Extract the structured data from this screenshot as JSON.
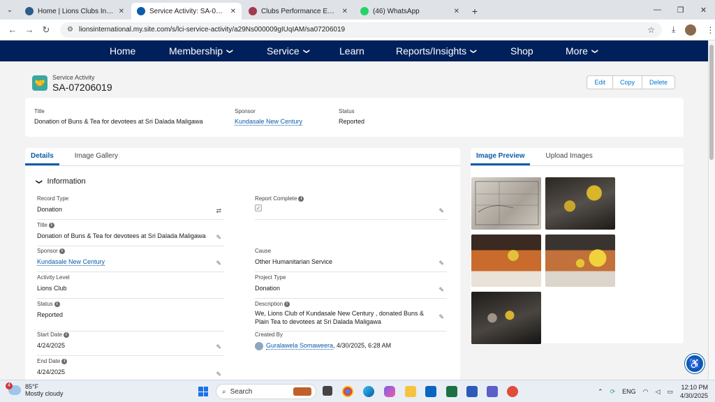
{
  "browser": {
    "tabs": [
      {
        "title": "Home | Lions Clubs Internationa...",
        "active": false,
        "color": "#2e5c8a"
      },
      {
        "title": "Service Activity: SA-07206019",
        "active": true,
        "color": "#0b5cab"
      },
      {
        "title": "Clubs Performance Evaluation S...",
        "active": false,
        "color": "#a33a4f"
      },
      {
        "title": "(46) WhatsApp",
        "active": false,
        "color": "#25d366"
      }
    ],
    "url": "lionsinternational.my.site.com/s/lci-service-activity/a29Ns000009gIUqIAM/sa07206019"
  },
  "nav": {
    "items": [
      {
        "label": "Home",
        "dropdown": false
      },
      {
        "label": "Membership",
        "dropdown": true
      },
      {
        "label": "Service",
        "dropdown": true
      },
      {
        "label": "Learn",
        "dropdown": false
      },
      {
        "label": "Reports/Insights",
        "dropdown": true
      },
      {
        "label": "Shop",
        "dropdown": false
      },
      {
        "label": "More",
        "dropdown": true
      }
    ]
  },
  "record": {
    "object_type": "Service Activity",
    "name": "SA-07206019",
    "buttons": [
      "Edit",
      "Copy",
      "Delete"
    ]
  },
  "highlights": [
    {
      "label": "Title",
      "value": "Donation of Buns & Tea for devotees at Sri Dalada Maligawa"
    },
    {
      "label": "Sponsor",
      "value": "Kundasale New Century"
    },
    {
      "label": "Status",
      "value": "Reported"
    }
  ],
  "left_tabs": [
    "Details",
    "Image Gallery"
  ],
  "section_title": "Information",
  "fields": {
    "record_type": {
      "label": "Record Type",
      "value": "Donation"
    },
    "report_complete": {
      "label": "Report Complete",
      "value": "✓"
    },
    "title": {
      "label": "Title",
      "value": "Donation of Buns & Tea for devotees at Sri Dalada Maligawa"
    },
    "sponsor": {
      "label": "Sponsor",
      "value": "Kundasale New Century"
    },
    "cause": {
      "label": "Cause",
      "value": "Other Humanitarian Service"
    },
    "activity_level": {
      "label": "Activity Level",
      "value": "Lions Club"
    },
    "project_type": {
      "label": "Project Type",
      "value": "Donation"
    },
    "status": {
      "label": "Status",
      "value": "Reported"
    },
    "description": {
      "label": "Description",
      "value": "We, Lions Club of Kundasale New Century , donated Buns & Plain Tea to devotees at Sri Dalada Maligawa"
    },
    "start_date": {
      "label": "Start Date",
      "value": "4/24/2025"
    },
    "created_by": {
      "label": "Created By",
      "user": "Guralawela Somaweera",
      "date": ", 4/30/2025, 6:28 AM"
    },
    "end_date": {
      "label": "End Date",
      "value": "4/24/2025"
    }
  },
  "right_tabs": [
    "Image Preview",
    "Upload Images"
  ],
  "taskbar": {
    "temp": "85°F",
    "weather": "Mostly cloudy",
    "badge": "4",
    "search": "Search",
    "lang": "ENG",
    "time": "12:10 PM",
    "date": "4/30/2025"
  }
}
